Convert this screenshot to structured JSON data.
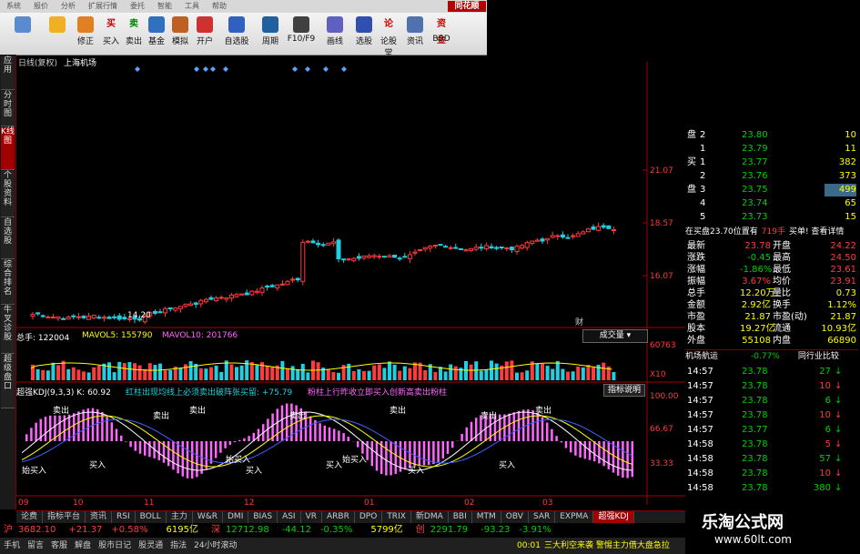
{
  "menu": [
    "系统",
    "报价",
    "分析",
    "扩展行情",
    "委托",
    "智能",
    "工具",
    "帮助"
  ],
  "brand": "同花顺",
  "toolbar": [
    {
      "name": "display-icon",
      "label": ""
    },
    {
      "name": "back-icon",
      "label": ""
    },
    {
      "name": "fix-icon",
      "label": "修正"
    },
    {
      "name": "buy-icon",
      "label": "买入",
      "glyph": "买"
    },
    {
      "name": "sell-icon",
      "label": "卖出",
      "glyph": "卖"
    },
    {
      "name": "fund-icon",
      "label": "基金"
    },
    {
      "name": "simulate-icon",
      "label": "模拟"
    },
    {
      "name": "open-account-icon",
      "label": "开户"
    },
    {
      "name": "watchlist-icon",
      "label": "自选股"
    },
    {
      "name": "period-icon",
      "label": "周期"
    },
    {
      "name": "f10-icon",
      "label": "F10/F9"
    },
    {
      "name": "draw-icon",
      "label": "画线"
    },
    {
      "name": "pick-icon",
      "label": "选股"
    },
    {
      "name": "comment-icon",
      "label": "论股堂",
      "glyph": "论"
    },
    {
      "name": "news-icon",
      "label": "资讯"
    },
    {
      "name": "fundflow-icon",
      "label": "BBD",
      "glyph": "资金"
    }
  ],
  "left_tabs": [
    "应用",
    "分时图",
    "K线图",
    "个股资料",
    "自选股",
    "综合排名",
    "牛叉诊股",
    "超级盘口"
  ],
  "chart": {
    "title": "日线(复权)",
    "stock": "上海机场",
    "price_labels": [
      "21.07",
      "18.57",
      "16.07"
    ],
    "low_label": "14.20",
    "volume_info": {
      "label": "总手: 122004",
      "vol5": "MAVOL5: 155790",
      "vol10": "MAVOL10: 201766"
    },
    "volume_select": "成交量",
    "volume_labels": [
      "60763",
      "X10"
    ],
    "kdj_info": "超强KDJ(9,3,3) K: 60.92",
    "kdj_hint": "红柱出现均线上必须卖出破阵张买留: +75.79",
    "kdj_hint2": "粉柱上行昨收立即买入创新高卖出粉柱",
    "kdj_help": "指标说明",
    "kdj_labels": [
      "100.00",
      "66.67",
      "33.33"
    ],
    "signals_buy": [
      "始买入",
      "买入",
      "始买入",
      "买入",
      "买入",
      "始买入",
      "买入",
      "买入"
    ],
    "signals_sell": [
      "卖出",
      "卖出",
      "卖出",
      "卖出",
      "卖出",
      "卖出",
      "卖出"
    ],
    "dates": [
      "09",
      "10",
      "11",
      "12",
      "01",
      "02",
      "03"
    ],
    "wealth_mark": "财"
  },
  "right_panel": {
    "orderbook": [
      {
        "side": "盘",
        "lvl": "2",
        "price": "23.80",
        "vol": "10"
      },
      {
        "side": "",
        "lvl": "1",
        "price": "23.79",
        "vol": "11"
      },
      {
        "side": "买",
        "lvl": "1",
        "price": "23.77",
        "vol": "382"
      },
      {
        "side": "",
        "lvl": "2",
        "price": "23.76",
        "vol": "373"
      },
      {
        "side": "盘",
        "lvl": "3",
        "price": "23.75",
        "vol": "499"
      },
      {
        "side": "",
        "lvl": "4",
        "price": "23.74",
        "vol": "65"
      },
      {
        "side": "",
        "lvl": "5",
        "price": "23.73",
        "vol": "15"
      }
    ],
    "buy_notice": "在买盘23.70位置有",
    "buy_notice2": "719手",
    "buy_notice3": "买单! 查看详情",
    "stats": [
      {
        "k1": "最新",
        "v1": "23.78",
        "k2": "开盘",
        "v2": "24.22"
      },
      {
        "k1": "涨跌",
        "v1": "-0.45",
        "k2": "最高",
        "v2": "24.50"
      },
      {
        "k1": "涨幅",
        "v1": "-1.86%",
        "k2": "最低",
        "v2": "23.61"
      },
      {
        "k1": "振幅",
        "v1": "3.67%",
        "k2": "均价",
        "v2": "23.91"
      },
      {
        "k1": "总手",
        "v1": "12.20万",
        "k2": "量比",
        "v2": "0.73"
      },
      {
        "k1": "金额",
        "v1": "2.92亿",
        "k2": "换手",
        "v2": "1.12%"
      },
      {
        "k1": "市盈",
        "v1": "21.87",
        "k2": "市盈(动)",
        "v2": "21.87"
      },
      {
        "k1": "股本",
        "v1": "19.27亿",
        "k2": "流通",
        "v2": "10.93亿"
      },
      {
        "k1": "外盘",
        "v1": "55108",
        "k2": "内盘",
        "v2": "66890"
      }
    ],
    "sector": "机场航运",
    "sector_chg": "-0.77%",
    "sector_compare": "同行业比较",
    "ticks": [
      {
        "t": "14:57",
        "p": "23.78",
        "v": "27"
      },
      {
        "t": "14:57",
        "p": "23.78",
        "v": "10"
      },
      {
        "t": "14:57",
        "p": "23.78",
        "v": "6"
      },
      {
        "t": "14:57",
        "p": "23.78",
        "v": "10"
      },
      {
        "t": "14:57",
        "p": "23.77",
        "v": "6"
      },
      {
        "t": "14:58",
        "p": "23.78",
        "v": "5"
      },
      {
        "t": "14:58",
        "p": "23.78",
        "v": "57"
      },
      {
        "t": "14:58",
        "p": "23.78",
        "v": "10"
      },
      {
        "t": "14:58",
        "p": "23.78",
        "v": "380"
      }
    ]
  },
  "bottom_tabs": [
    "论费",
    "指标平台",
    "资讯",
    "RSI",
    "BOLL",
    "主力",
    "W&R",
    "DMI",
    "BIAS",
    "ASI",
    "VR",
    "ARBR",
    "DPO",
    "TRIX",
    "新DMA",
    "BBI",
    "MTM",
    "OBV",
    "SAR",
    "EXPMA",
    "超强KDJ"
  ],
  "index_bar": [
    {
      "name": "沪",
      "val": "3682.10",
      "chg": "+21.37",
      "pct": "+0.58%",
      "amt": "6195亿"
    },
    {
      "name": "深",
      "val": "12712.98",
      "chg": "-44.12",
      "pct": "-0.35%",
      "amt": "5799亿"
    },
    {
      "name": "创",
      "val": "2291.79",
      "chg": "-93.23",
      "pct": "-3.91%",
      "amt": ""
    }
  ],
  "status": {
    "items": [
      "手机",
      "留言",
      "客服",
      "解盘",
      "股市日记",
      "股灵通",
      "指法",
      "24小时滚动"
    ],
    "time": "00:01",
    "news": "三大利空来袭 警惕主力借大盘急拉"
  },
  "watermark": {
    "title": "乐淘公式网",
    "url": "www.60lt.com"
  },
  "colors": {
    "up": "#ff3b3b",
    "down": "#00d000",
    "cyan": "#20d0e0",
    "pink": "#ff66ff",
    "axis": "#a00000",
    "yellow": "#ffff00"
  }
}
